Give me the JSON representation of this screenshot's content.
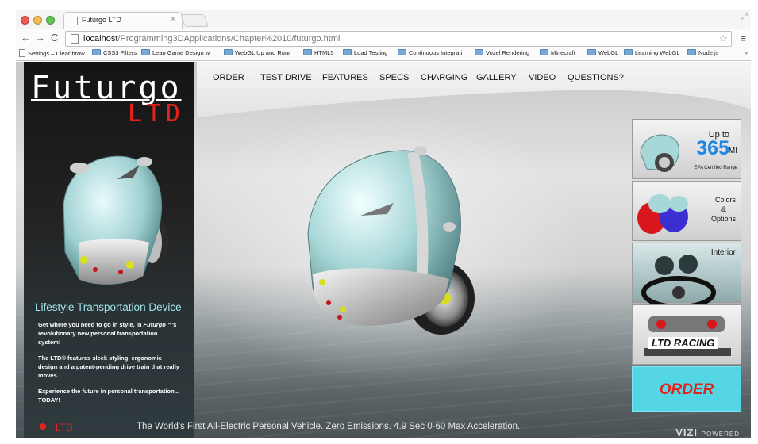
{
  "browser": {
    "tab_title": "Futurgo LTD",
    "tab_close": "×",
    "url_host": "localhost",
    "url_path": "/Programming3DApplications/Chapter%2010/futurgo.html",
    "bookmarks": [
      "Settings – Clear brow",
      "CSS3 Filters",
      "Lean Game Design w",
      "WebGL Up and Runn",
      "HTML5",
      "Load Testing",
      "Continuous Integrati",
      "Voxel Rendering",
      "Minecraft",
      "WebGL",
      "Learning WebGL",
      "Node.js"
    ],
    "bookmarks_more": "»"
  },
  "brand": {
    "logo": "Futurgo",
    "sub": "LTD"
  },
  "nav": [
    "ORDER",
    "TEST DRIVE",
    "FEATURES",
    "SPECS",
    "CHARGING",
    "GALLERY",
    "VIDEO",
    "QUESTIONS?"
  ],
  "left": {
    "title": "Lifestyle Transportation Device",
    "p1a": "Get where you need to go in style, in ",
    "p1b": "Futurgo",
    "p1c": "™'s revolutionary new personal transportation system!",
    "p2": "The LTD® features sleek styling, ergonomic design and a patent-pending drive train that really moves.",
    "p3": "Experience the future in personal transportation... TODAY!"
  },
  "tiles": {
    "range_up": "Up to",
    "range_value": "365",
    "range_unit": "MI",
    "range_note": "EPA Certified Range",
    "colors": "Colors\n&\nOptions",
    "colors_1": "Colors",
    "colors_2": "&",
    "colors_3": "Options",
    "interior": "Interior",
    "racing": "LTD RACING",
    "order": "ORDER"
  },
  "footer": {
    "ltd": "LTD",
    "tagline": "The World's First All-Electric Personal Vehicle. Zero Emissions. 4.9 Sec 0-60 Max Acceleration.",
    "vizi": "VIZI",
    "vizi_powered": "POWERED"
  },
  "colors": {
    "accent_red": "#e3231b",
    "accent_cyan": "#54d6e4",
    "range_blue": "#1d87e6"
  }
}
